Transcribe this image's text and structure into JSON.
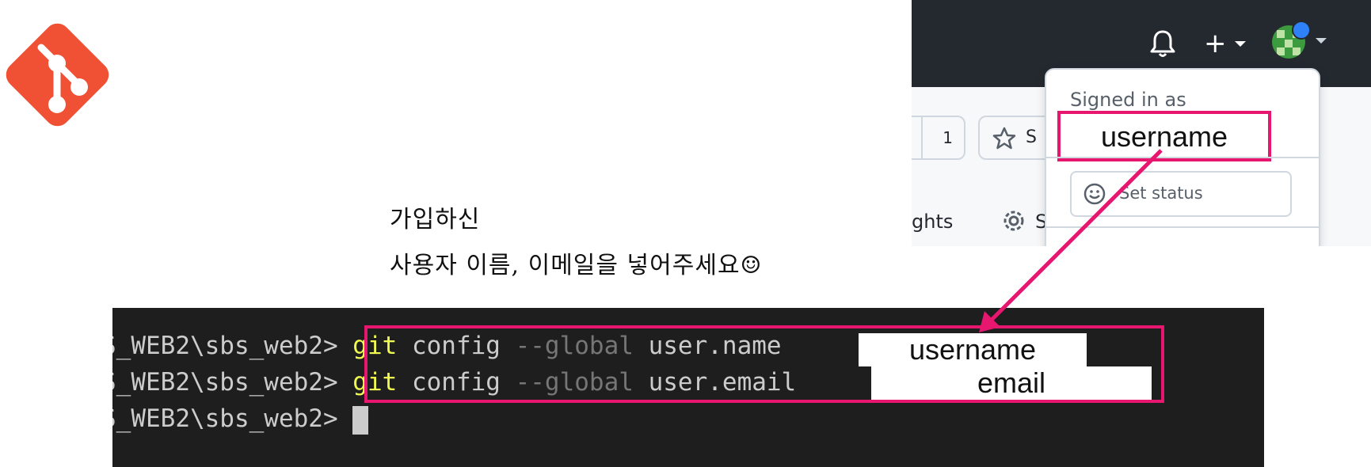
{
  "caption": {
    "line1": "가입하신",
    "line2": "사용자 이름, 이메일을 넣어주세요☺"
  },
  "github": {
    "signed_in_label": "Signed in as",
    "username": "username",
    "set_status_label": "Set status",
    "count": "1",
    "star_partial": "S",
    "insights_partial": "ghts",
    "settings_partial": "S",
    "plus": "+"
  },
  "terminal": {
    "prompt": "S_WEB2\\sbs_web2>",
    "line1": {
      "cmd": "git",
      "config": " config ",
      "flag": "--global",
      "key": " user.name",
      "value": "username"
    },
    "line2": {
      "cmd": "git",
      "config": " config ",
      "flag": "--global",
      "key": " user.email",
      "value": "email"
    }
  },
  "colors": {
    "highlight": "#e7166f",
    "git_brand": "#f05033",
    "github_header": "#24292f",
    "terminal_bg": "#1e1e1e",
    "git_keyword": "#f1fa4f"
  }
}
